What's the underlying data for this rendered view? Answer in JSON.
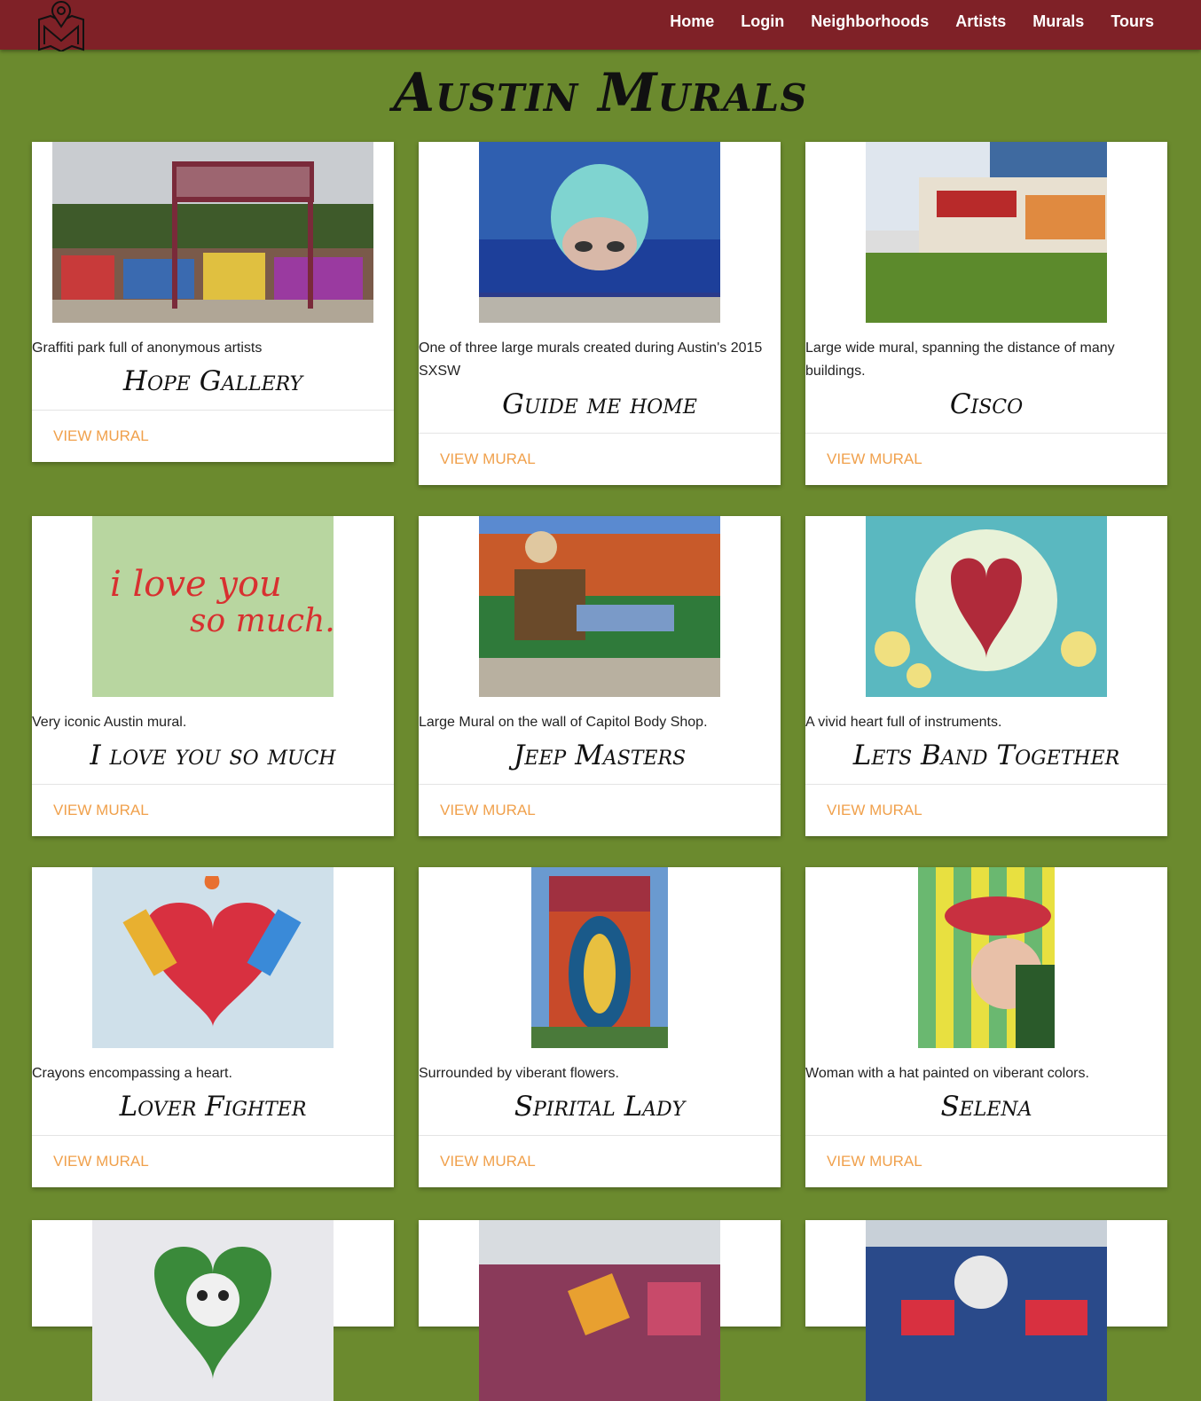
{
  "nav": {
    "logo": "map-pin-logo",
    "links": [
      "Home",
      "Login",
      "Neighborhoods",
      "Artists",
      "Murals",
      "Tours"
    ]
  },
  "page": {
    "title": "Austin Murals"
  },
  "cards": [
    {
      "desc": "Graffiti park full of anonymous artists",
      "title": "Hope Gallery",
      "action": "VIEW MURAL"
    },
    {
      "desc": "One of three large murals created during Austin's 2015 SXSW",
      "title": "Guide me home",
      "action": "VIEW MURAL"
    },
    {
      "desc": "Large wide mural, spanning the distance of many buildings.",
      "title": "Cisco",
      "action": "VIEW MURAL"
    },
    {
      "desc": "Very iconic Austin mural.",
      "title": "I love you so much",
      "action": "VIEW MURAL",
      "image_text_1": "i love you",
      "image_text_2": "so much."
    },
    {
      "desc": "Large Mural on the wall of Capitol Body Shop.",
      "title": "Jeep Masters",
      "action": "VIEW MURAL"
    },
    {
      "desc": "A vivid heart full of instruments.",
      "title": "Lets Band Together",
      "action": "VIEW MURAL"
    },
    {
      "desc": "Crayons encompassing a heart.",
      "title": "Lover Fighter",
      "action": "VIEW MURAL"
    },
    {
      "desc": "Surrounded by viberant flowers.",
      "title": "Spirital Lady",
      "action": "VIEW MURAL"
    },
    {
      "desc": "Woman with a hat painted on viberant colors.",
      "title": "Selena",
      "action": "VIEW MURAL"
    }
  ],
  "colors": {
    "nav_bg": "#7f2127",
    "page_bg": "#6b8a2e",
    "action": "#f0a04b"
  }
}
